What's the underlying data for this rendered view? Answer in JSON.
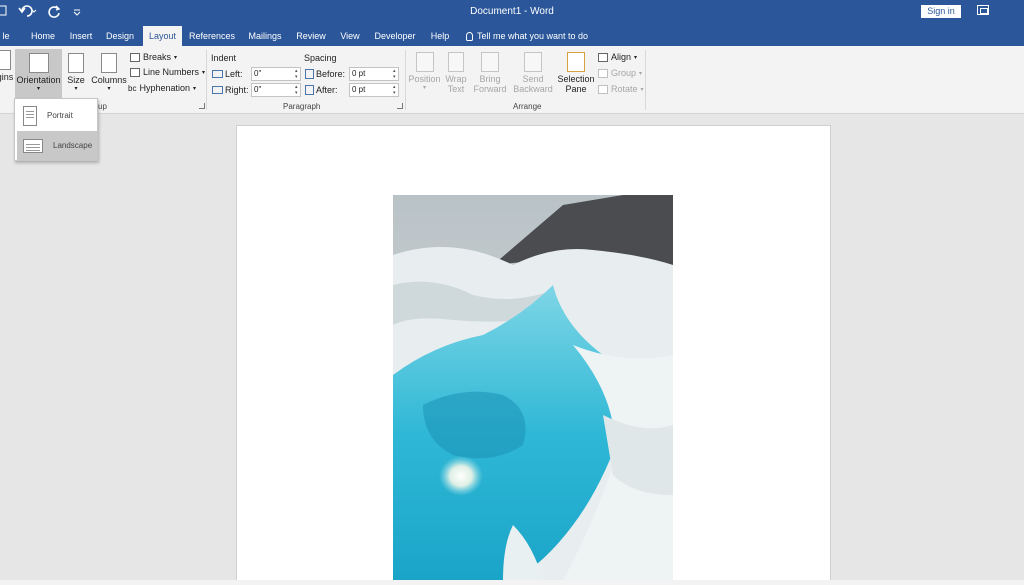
{
  "title_bar": {
    "document_title": "Document1 - Word",
    "sign_in_label": "Sign in",
    "qat_icons": [
      "save-icon",
      "undo-icon",
      "redo-icon",
      "customize-qat-icon"
    ]
  },
  "tabs": [
    {
      "label": "le",
      "active": false
    },
    {
      "label": "Home",
      "active": false
    },
    {
      "label": "Insert",
      "active": false
    },
    {
      "label": "Design",
      "active": false
    },
    {
      "label": "Layout",
      "active": true
    },
    {
      "label": "References",
      "active": false
    },
    {
      "label": "Mailings",
      "active": false
    },
    {
      "label": "Review",
      "active": false
    },
    {
      "label": "View",
      "active": false
    },
    {
      "label": "Developer",
      "active": false
    },
    {
      "label": "Help",
      "active": false
    }
  ],
  "tell_me": "Tell me what you want to do",
  "ribbon": {
    "page_setup": {
      "margins_label": "gins",
      "orientation_label": "Orientation",
      "size_label": "Size",
      "columns_label": "Columns",
      "breaks_label": "Breaks",
      "line_numbers_label": "Line Numbers",
      "hyphenation_label": "Hyphenation",
      "hyphenation_prefix": "bc",
      "group_label": "up"
    },
    "paragraph": {
      "indent_header": "Indent",
      "spacing_header": "Spacing",
      "left_label": "Left:",
      "left_value": "0\"",
      "right_label": "Right:",
      "right_value": "0\"",
      "before_label": "Before:",
      "before_value": "0 pt",
      "after_label": "After:",
      "after_value": "0 pt",
      "group_label": "Paragraph"
    },
    "arrange": {
      "position_label": "Position",
      "wrap_text_label_1": "Wrap",
      "wrap_text_label_2": "Text",
      "bring_forward_label_1": "Bring",
      "bring_forward_label_2": "Forward",
      "send_backward_label_1": "Send",
      "send_backward_label_2": "Backward",
      "selection_pane_label_1": "Selection",
      "selection_pane_label_2": "Pane",
      "align_label": "Align",
      "group_obj_label": "Group",
      "rotate_label": "Rotate",
      "group_label": "Arrange"
    }
  },
  "orientation_menu": {
    "items": [
      {
        "label": "Portrait",
        "highlighted": false
      },
      {
        "label": "Landscape",
        "highlighted": true
      }
    ]
  },
  "colors": {
    "word_blue": "#2b579a",
    "ribbon_bg": "#f3f3f3",
    "canvas_bg": "#e6e6e6",
    "ice_blue": "#3cc4dc"
  }
}
